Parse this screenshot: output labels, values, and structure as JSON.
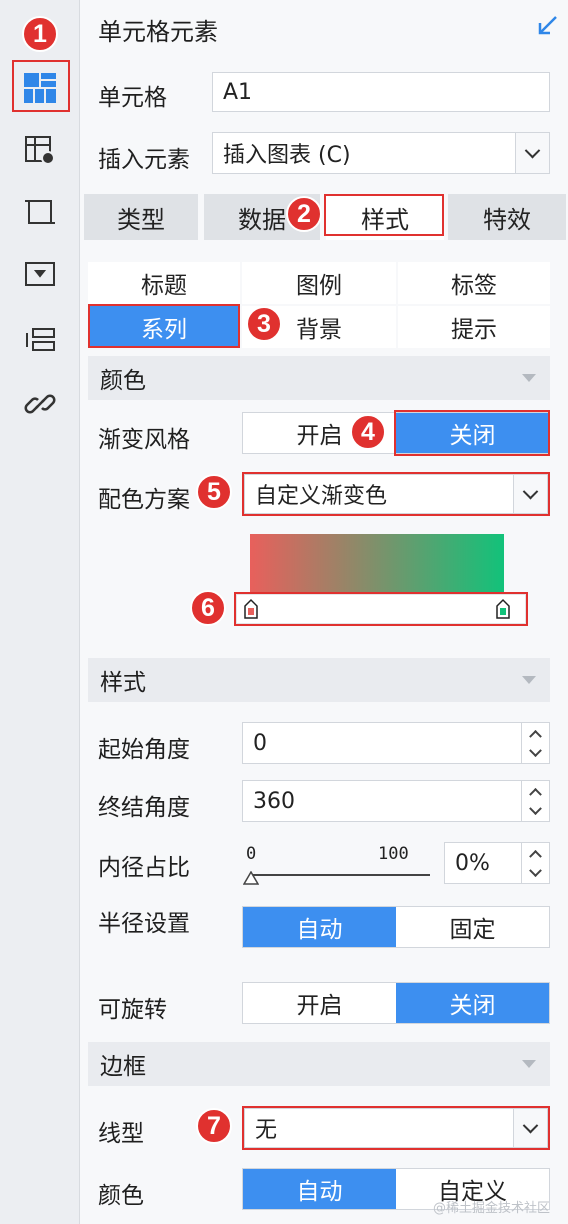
{
  "header": {
    "title": "单元格元素"
  },
  "cell": {
    "label": "单元格",
    "value": "A1"
  },
  "insert": {
    "label": "插入元素",
    "value": "插入图表 (C)"
  },
  "tabs": [
    {
      "label": "类型"
    },
    {
      "label": "数据"
    },
    {
      "label": "样式"
    },
    {
      "label": "特效"
    }
  ],
  "subtabs": [
    {
      "label": "标题"
    },
    {
      "label": "图例"
    },
    {
      "label": "标签"
    },
    {
      "label": "系列"
    },
    {
      "label": "背景"
    },
    {
      "label": "提示"
    }
  ],
  "color_section": {
    "title": "颜色",
    "gradient_style": {
      "label": "渐变风格",
      "on": "开启",
      "off": "关闭",
      "selected": "关闭"
    },
    "scheme": {
      "label": "配色方案",
      "value": "自定义渐变色"
    },
    "gradient": {
      "start_color": "#e8605c",
      "end_color": "#12c27a"
    }
  },
  "style_section": {
    "title": "样式",
    "start_angle": {
      "label": "起始角度",
      "value": "0"
    },
    "end_angle": {
      "label": "终结角度",
      "value": "360"
    },
    "inner_ratio": {
      "label": "内径占比",
      "min": "0",
      "max": "100",
      "value": "0%"
    },
    "radius": {
      "label": "半径设置",
      "auto": "自动",
      "fixed": "固定",
      "selected": "自动"
    },
    "rotatable": {
      "label": "可旋转",
      "on": "开启",
      "off": "关闭",
      "selected": "关闭"
    }
  },
  "border_section": {
    "title": "边框",
    "line_type": {
      "label": "线型",
      "value": "无"
    },
    "color": {
      "label": "颜色",
      "auto": "自动",
      "custom": "自定义",
      "selected": "自动"
    }
  },
  "badges": [
    "1",
    "2",
    "3",
    "4",
    "5",
    "6",
    "7"
  ],
  "watermark": "@稀土掘金技术社区",
  "colors": {
    "accent": "#3d8ff0",
    "highlight": "#e0312f",
    "sidebar_active": "#2f86e8"
  }
}
